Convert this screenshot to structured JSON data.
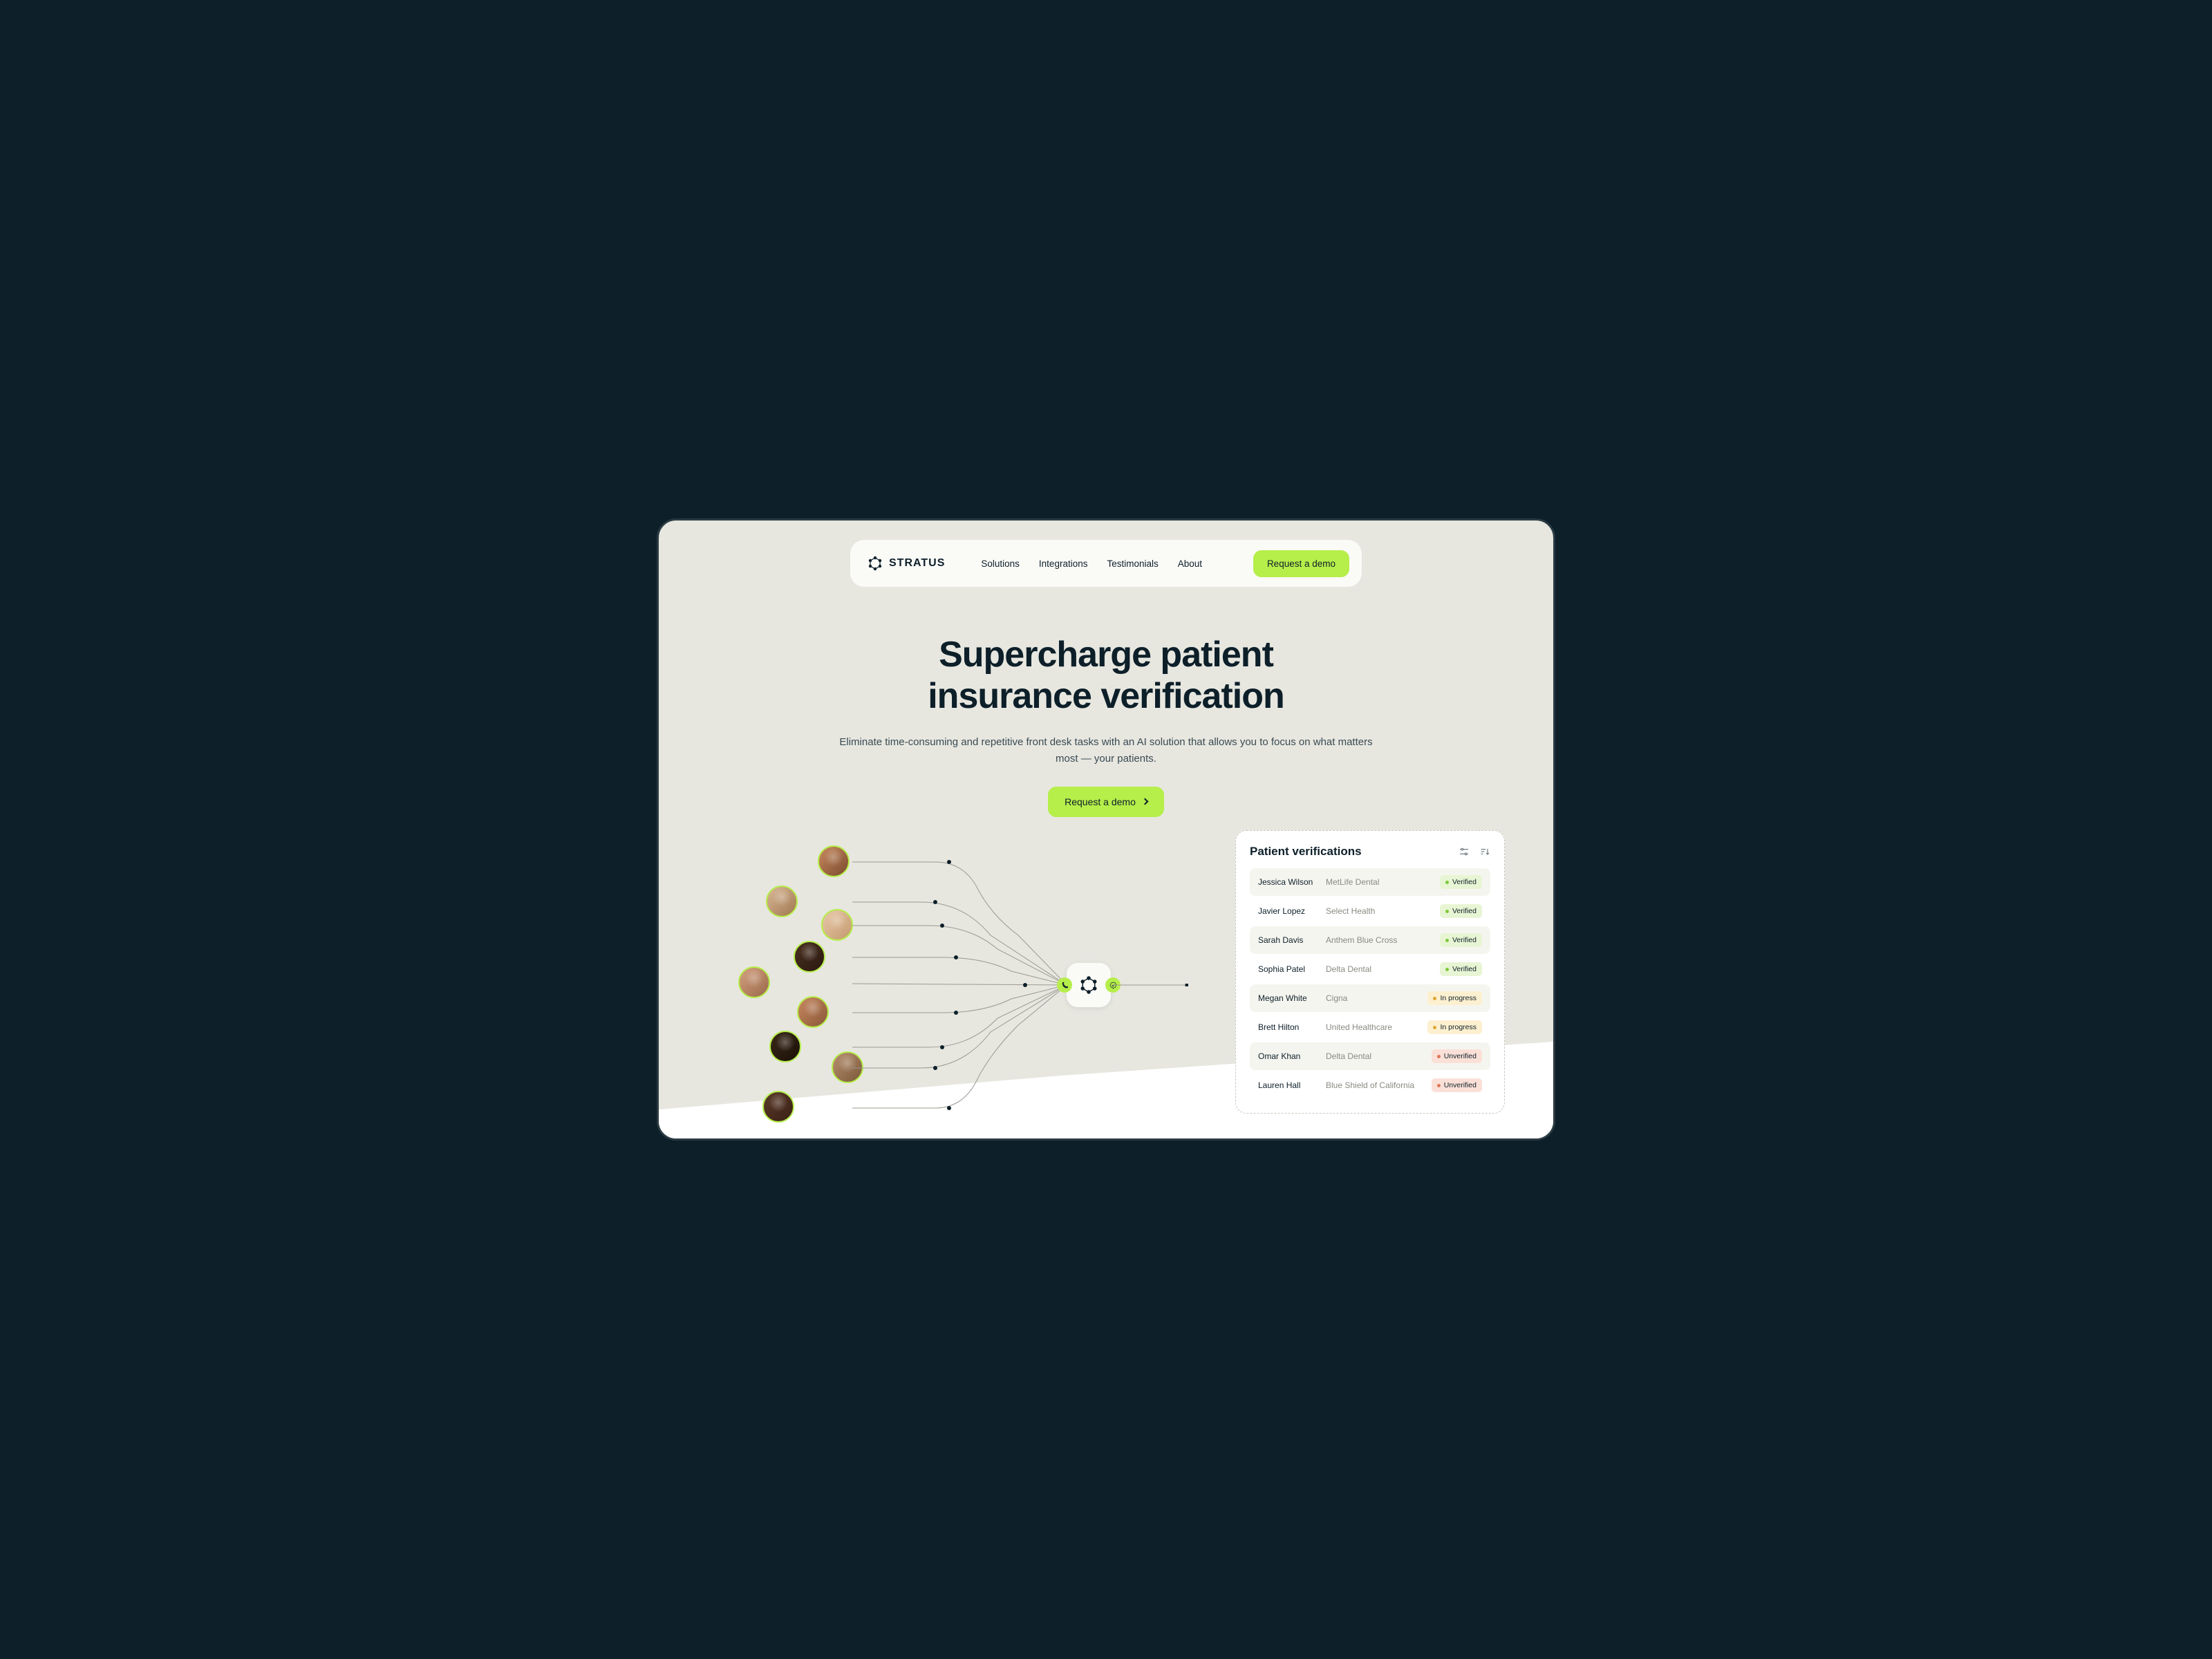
{
  "brand": {
    "name": "STRATUS"
  },
  "nav": {
    "links": [
      "Solutions",
      "Integrations",
      "Testimonials",
      "About"
    ],
    "cta": "Request a demo"
  },
  "hero": {
    "title_line1": "Supercharge patient",
    "title_line2": "insurance verification",
    "subtitle": "Eliminate time-consuming and repetitive front desk tasks with an AI solution that allows you to focus on what matters most — your patients.",
    "cta": "Request a demo"
  },
  "panel": {
    "title": "Patient verifications",
    "rows": [
      {
        "name": "Jessica Wilson",
        "provider": "MetLife Dental",
        "status": "Verified",
        "status_type": "verified"
      },
      {
        "name": "Javier Lopez",
        "provider": "Select Health",
        "status": "Verified",
        "status_type": "verified"
      },
      {
        "name": "Sarah Davis",
        "provider": "Anthem Blue Cross",
        "status": "Verified",
        "status_type": "verified"
      },
      {
        "name": "Sophia Patel",
        "provider": "Delta Dental",
        "status": "Verified",
        "status_type": "verified"
      },
      {
        "name": "Megan White",
        "provider": "Cigna",
        "status": "In progress",
        "status_type": "inprogress"
      },
      {
        "name": "Brett Hilton",
        "provider": "United Healthcare",
        "status": "In progress",
        "status_type": "inprogress"
      },
      {
        "name": "Omar Khan",
        "provider": "Delta Dental",
        "status": "Unverified",
        "status_type": "unverified"
      },
      {
        "name": "Lauren Hall",
        "provider": "Blue Shield of California",
        "status": "Unverified",
        "status_type": "unverified"
      }
    ]
  },
  "colors": {
    "accent": "#b6ee4a",
    "bg_dark": "#0d1f29",
    "bg_page": "#e7e7e0"
  }
}
